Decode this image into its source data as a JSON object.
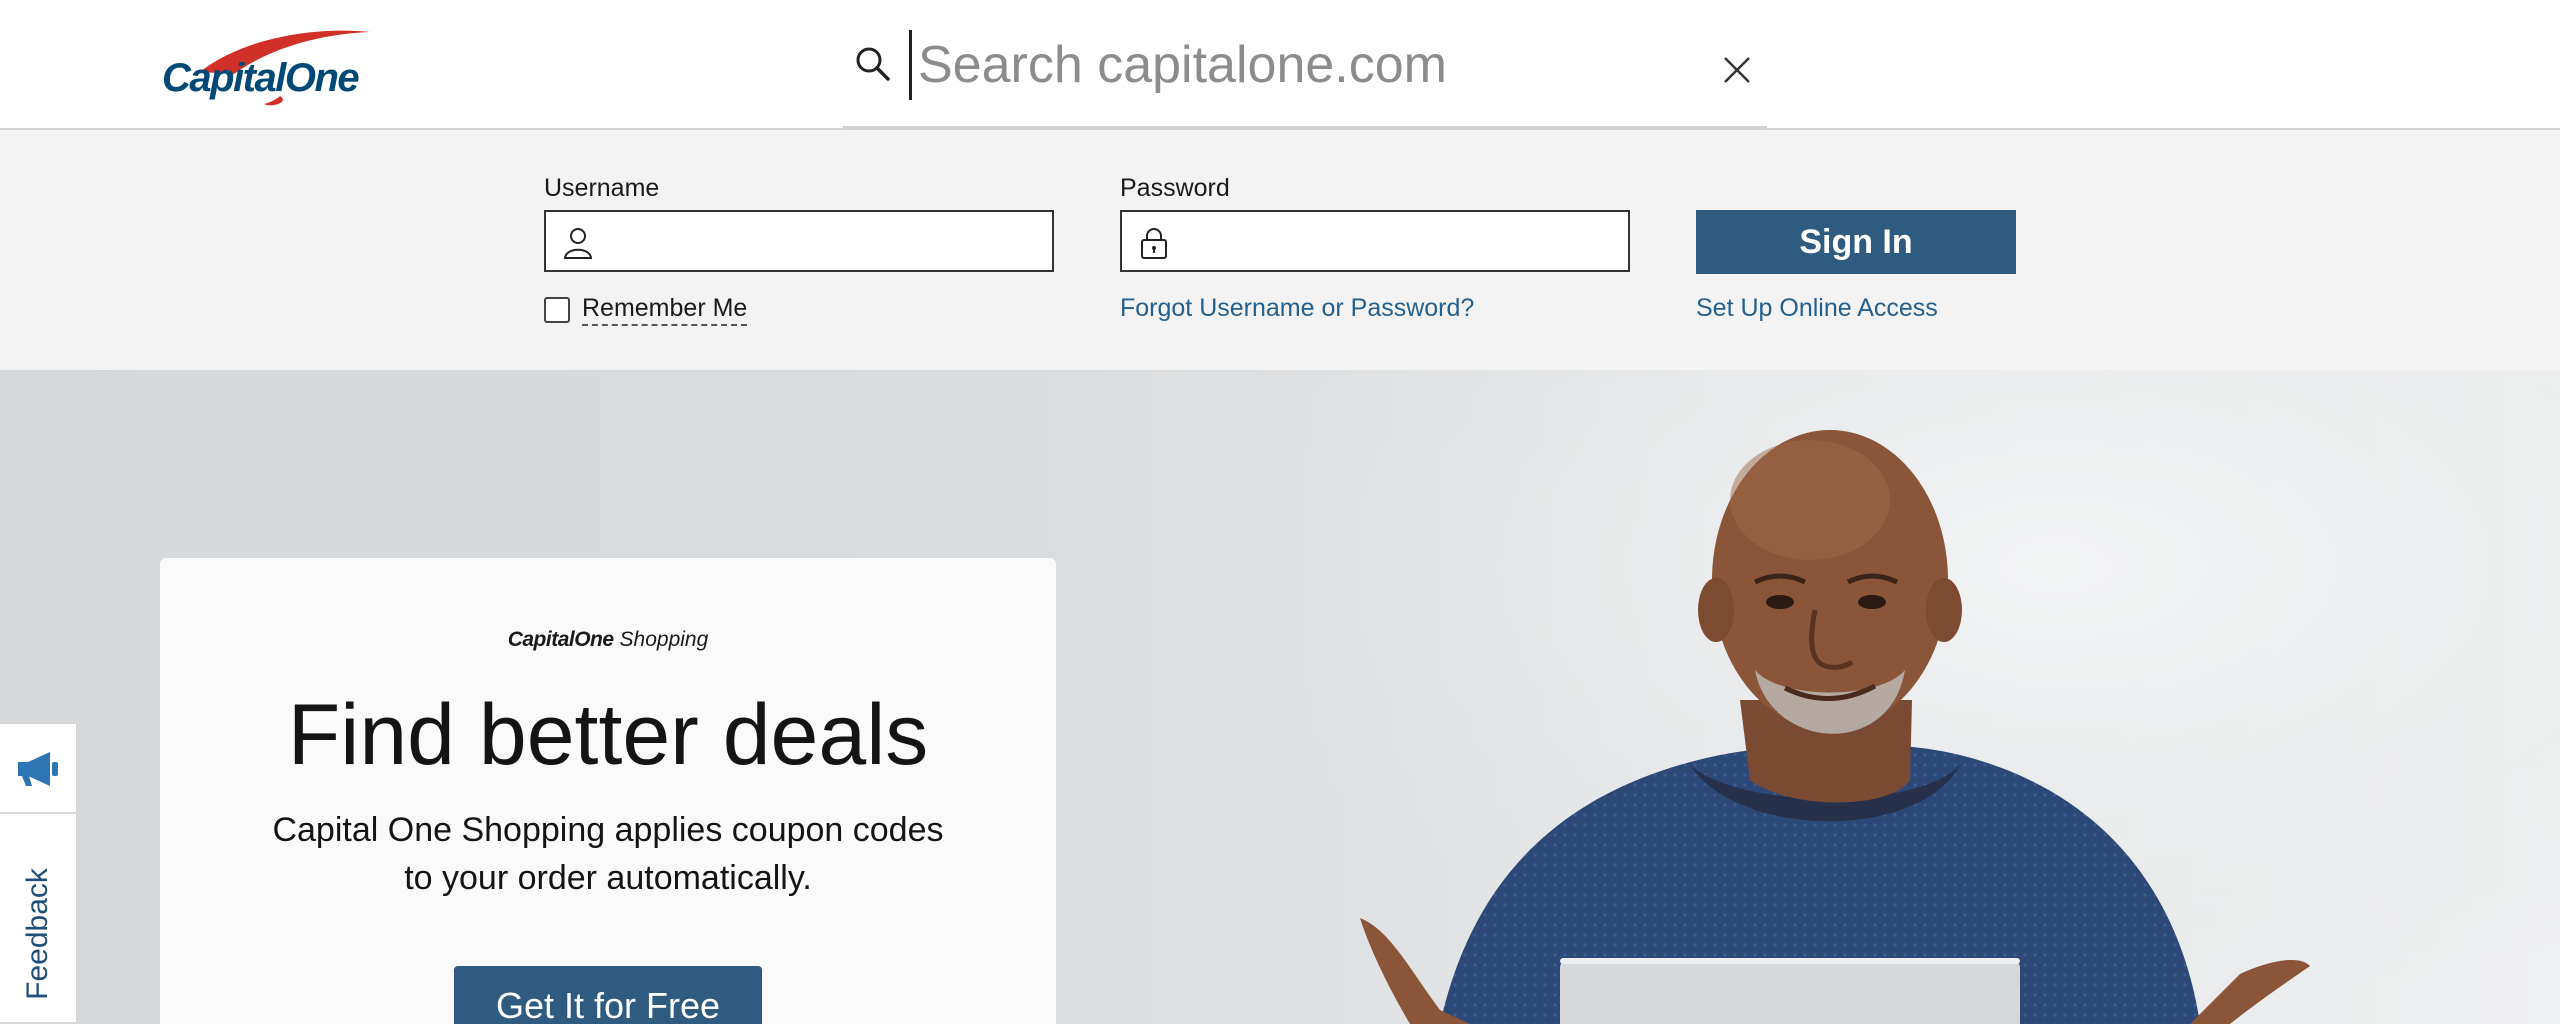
{
  "header": {
    "logo_text": "CapitalOne",
    "search_placeholder": "Search capitalone.com",
    "search_value": ""
  },
  "login": {
    "username_label": "Username",
    "password_label": "Password",
    "signin_label": "Sign In",
    "remember_label": "Remember Me",
    "remember_checked": false,
    "forgot_link": "Forgot Username or Password?",
    "setup_link": "Set Up Online Access"
  },
  "promo": {
    "logo_capital_one": "CapitalOne",
    "logo_shopping": "Shopping",
    "title": "Find better deals",
    "body": "Capital One Shopping applies coupon codes to your order automatically.",
    "cta": "Get It for Free"
  },
  "feedback": {
    "label": "Feedback"
  },
  "colors": {
    "brand_blue": "#004977",
    "brand_red": "#d03027",
    "button_blue": "#2f5b80",
    "link_blue": "#255f8e"
  },
  "icons": [
    "search-icon",
    "close-icon",
    "user-icon",
    "lock-icon",
    "megaphone-icon"
  ]
}
